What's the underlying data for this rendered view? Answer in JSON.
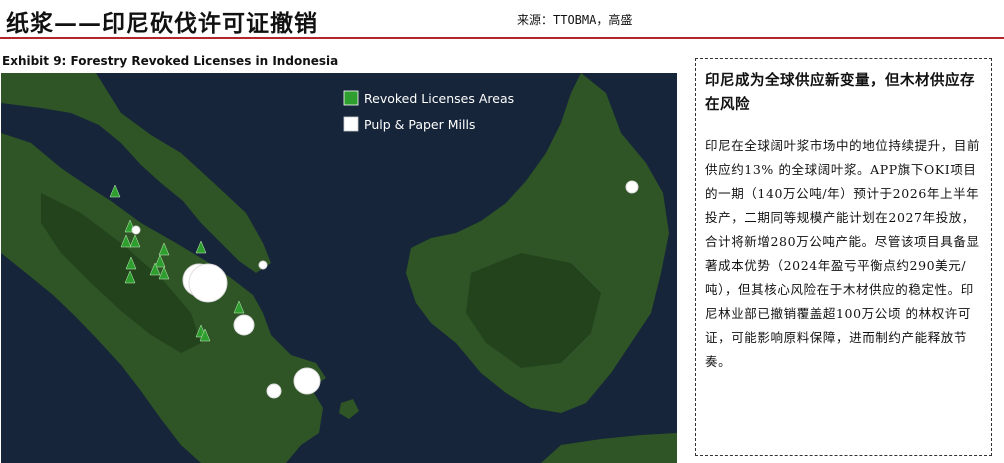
{
  "header": {
    "title": "纸浆——印尼砍伐许可证撤销",
    "source": "来源：TTOBMA，高盛"
  },
  "exhibit": {
    "title": "Exhibit 9: Forestry Revoked Licenses in Indonesia"
  },
  "map": {
    "legend": {
      "revoked": {
        "label": "Revoked Licenses Areas",
        "color": "#2e9e2e"
      },
      "mills": {
        "label": "Pulp & Paper Mills",
        "color": "#ffffff"
      }
    },
    "colors": {
      "sea": "#16253a",
      "land": "#2f5526",
      "land_dark": "#23431c",
      "marker": "#2e9e2e"
    }
  },
  "panel": {
    "heading": "印尼成为全球供应新变量，但木材供应存在风险",
    "body": "印尼在全球阔叶浆市场中的地位持续提升，目前供应约13% 的全球阔叶浆。APP旗下OKI项目的一期（140万公吨/年）预计于2026年上半年投产，二期同等规模产能计划在2027年投放，合计将新增280万公吨产能。尽管该项目具备显著成本优势（2024年盈亏平衡点约290美元/吨），但其核心风险在于木材供应的稳定性。印尼林业部已撤销覆盖超100万公顷 的林权许可证，可能影响原料保障，进而制约产能释放节奏。"
  }
}
